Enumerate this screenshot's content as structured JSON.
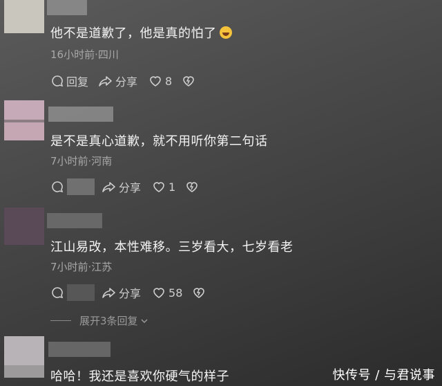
{
  "comments": [
    {
      "text": "他不是道歉了，他是真的怕了",
      "meta": "16小时前·四川",
      "reply_label": "回复",
      "share_label": "分享",
      "like_count": "8"
    },
    {
      "text": "是不是真心道歉，就不用听你第二句话",
      "meta": "7小时前·河南",
      "share_label": "分享",
      "like_count": "1"
    },
    {
      "text": "江山易改，本性难移。三岁看大，七岁看老",
      "meta": "7小时前·江苏",
      "share_label": "分享",
      "like_count": "58"
    },
    {
      "text": "哈哈！我还是喜欢你硬气的样子"
    }
  ],
  "expand_replies": "展开3条回复",
  "watermark": "快传号 / 与君说事",
  "icons": [
    "comment-icon",
    "share-icon",
    "heart-icon",
    "dislike-heart-icon",
    "chevron-down-icon",
    "laughing-emoji-icon"
  ]
}
